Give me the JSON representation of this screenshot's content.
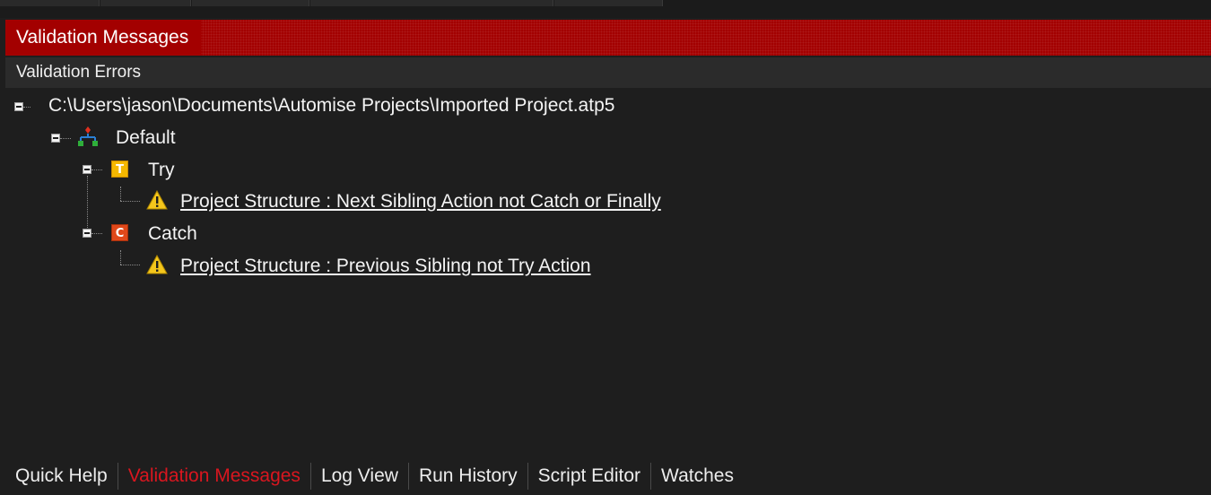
{
  "panel": {
    "title": "Validation Messages"
  },
  "section": {
    "label": "Validation Errors"
  },
  "tree": {
    "root": {
      "label": "C:\\Users\\jason\\Documents\\Automise Projects\\Imported Project.atp5"
    },
    "stage": {
      "label": "Default",
      "icon": "hierarchy-icon"
    },
    "try_node": {
      "label": "Try",
      "icon_letter": "T",
      "icon_color": "#f5b800"
    },
    "try_message": {
      "label": "Project Structure : Next Sibling Action not Catch or Finally",
      "icon": "warning-icon"
    },
    "catch_node": {
      "label": "Catch",
      "icon_letter": "C",
      "icon_color": "#e0481a"
    },
    "catch_message": {
      "label": "Project Structure : Previous Sibling not Try Action",
      "icon": "warning-icon"
    }
  },
  "tabs": [
    {
      "label": "Quick Help",
      "active": false
    },
    {
      "label": "Validation Messages",
      "active": true
    },
    {
      "label": "Log View",
      "active": false
    },
    {
      "label": "Run History",
      "active": false
    },
    {
      "label": "Script Editor",
      "active": false
    },
    {
      "label": "Watches",
      "active": false
    }
  ],
  "colors": {
    "header_bg": "#a30000",
    "active_tab": "#d9161f",
    "background": "#1e1e1e"
  }
}
